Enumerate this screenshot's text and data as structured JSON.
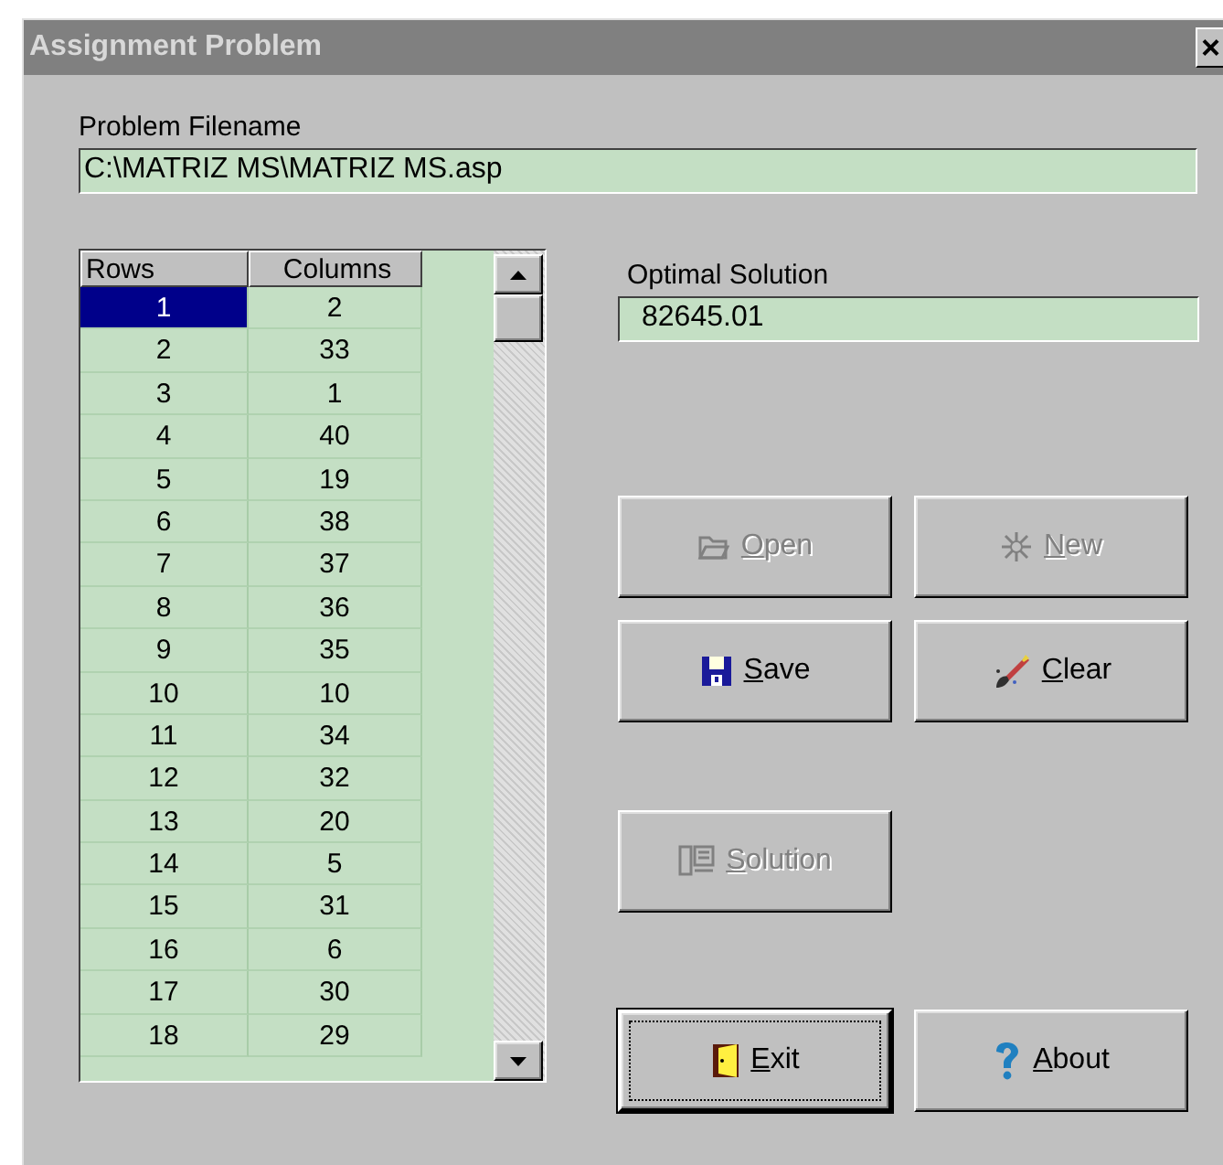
{
  "window": {
    "title": "Assignment Problem",
    "close": "×"
  },
  "filename": {
    "label": "Problem Filename",
    "value": "C:\\MATRIZ MS\\MATRIZ MS.asp"
  },
  "grid": {
    "columns": [
      "Rows",
      "Columns"
    ],
    "rows": [
      {
        "cells": [
          "1",
          "2"
        ],
        "selected": true
      },
      {
        "cells": [
          "2",
          "33"
        ],
        "selected": false
      },
      {
        "cells": [
          "3",
          "1"
        ],
        "selected": false
      },
      {
        "cells": [
          "4",
          "40"
        ],
        "selected": false
      },
      {
        "cells": [
          "5",
          "19"
        ],
        "selected": false
      },
      {
        "cells": [
          "6",
          "38"
        ],
        "selected": false
      },
      {
        "cells": [
          "7",
          "37"
        ],
        "selected": false
      },
      {
        "cells": [
          "8",
          "36"
        ],
        "selected": false
      },
      {
        "cells": [
          "9",
          "35"
        ],
        "selected": false
      },
      {
        "cells": [
          "10",
          "10"
        ],
        "selected": false
      },
      {
        "cells": [
          "11",
          "34"
        ],
        "selected": false
      },
      {
        "cells": [
          "12",
          "32"
        ],
        "selected": false
      },
      {
        "cells": [
          "13",
          "20"
        ],
        "selected": false
      },
      {
        "cells": [
          "14",
          "5"
        ],
        "selected": false
      },
      {
        "cells": [
          "15",
          "31"
        ],
        "selected": false
      },
      {
        "cells": [
          "16",
          "6"
        ],
        "selected": false
      },
      {
        "cells": [
          "17",
          "30"
        ],
        "selected": false
      },
      {
        "cells": [
          "18",
          "29"
        ],
        "selected": false
      }
    ]
  },
  "solution": {
    "label": "Optimal Solution",
    "value": "82645.01"
  },
  "buttons": [
    {
      "label": "Open",
      "disabled": true,
      "focused": false
    },
    {
      "label": "New",
      "disabled": true,
      "focused": false
    },
    {
      "label": "Save",
      "disabled": false,
      "focused": false
    },
    {
      "label": "Clear",
      "disabled": false,
      "focused": false
    },
    {
      "label": "Solution",
      "disabled": true,
      "focused": false
    },
    {
      "label": "Exit",
      "disabled": false,
      "focused": true
    },
    {
      "label": "About",
      "disabled": false,
      "focused": false
    }
  ]
}
